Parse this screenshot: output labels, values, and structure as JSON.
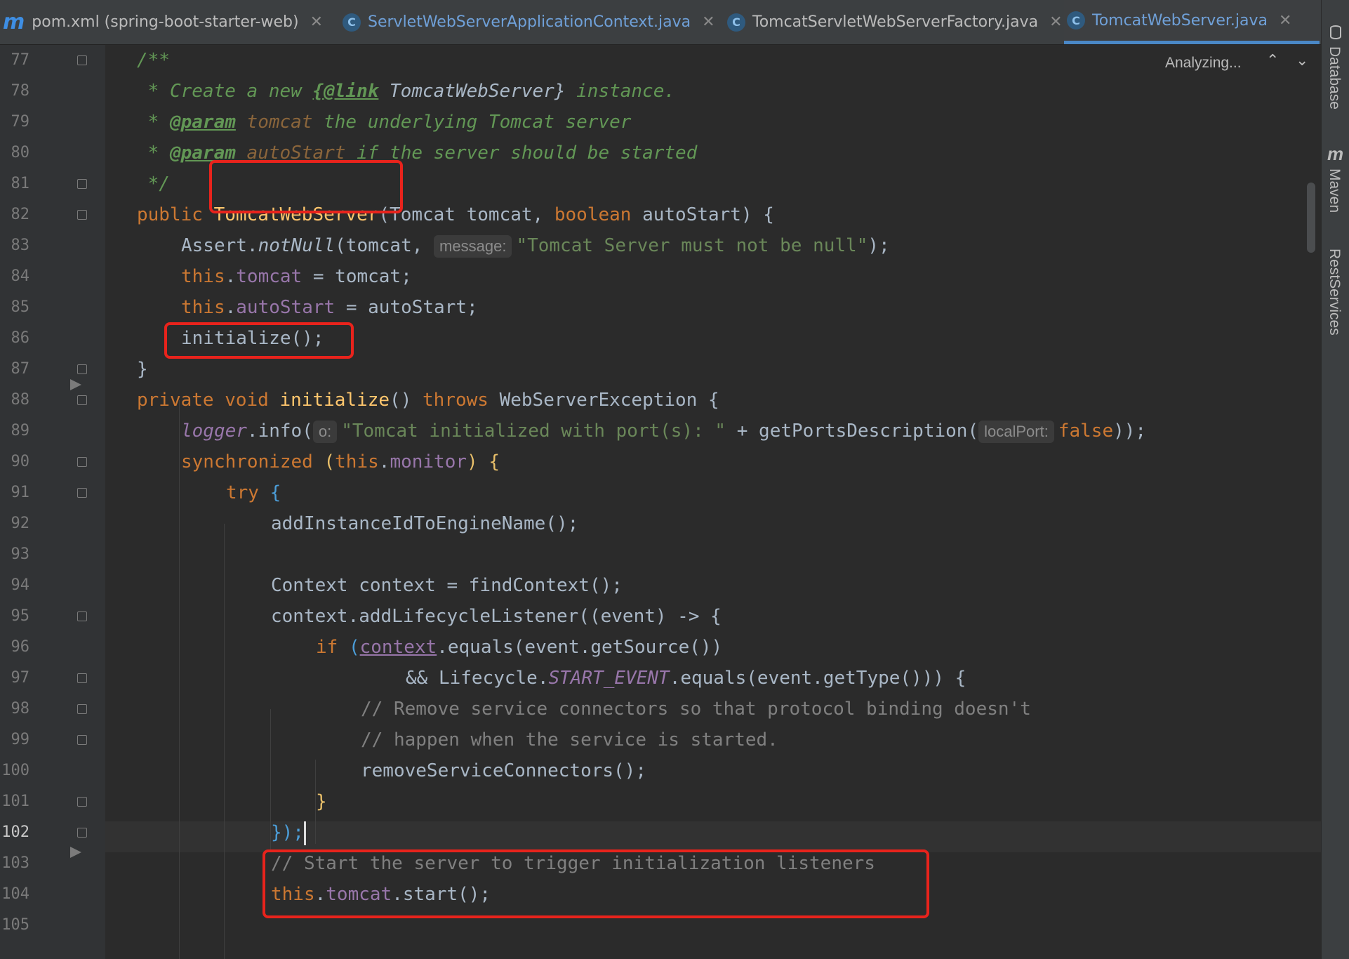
{
  "tabs": [
    {
      "label": "pom.xml (spring-boot-starter-web)",
      "icon": "maven-icon",
      "active": false
    },
    {
      "label": "ServletWebServerApplicationContext.java",
      "icon": "class-icon",
      "active": false
    },
    {
      "label": "TomcatServletWebServerFactory.java",
      "icon": "class-icon",
      "active": false
    },
    {
      "label": "TomcatWebServer.java",
      "icon": "class-icon",
      "active": true
    }
  ],
  "tab_close_glyph": "✕",
  "class_icon_glyph": "C",
  "maven_icon_glyph": "m",
  "status": {
    "analyzing": "Analyzing...",
    "up_glyph": "⌃",
    "down_glyph": "⌄"
  },
  "right_panels": [
    {
      "label": "Database"
    },
    {
      "label": "Maven"
    },
    {
      "label": "RestServices"
    }
  ],
  "line_numbers": [
    "77",
    "78",
    "79",
    "80",
    "81",
    "82",
    "83",
    "84",
    "85",
    "86",
    "87",
    "88",
    "89",
    "90",
    "91",
    "92",
    "93",
    "94",
    "95",
    "96",
    "97",
    "98",
    "99",
    "100",
    "101",
    "102",
    "103",
    "104",
    "105"
  ],
  "current_line": "102",
  "code": {
    "l77": "/**",
    "l78_a": " * Create a new ",
    "l78_b": "{@link",
    "l78_c": " TomcatWebServer}",
    "l78_d": " instance.",
    "l79_a": " * ",
    "l79_b": "@param",
    "l79_c": " tomcat",
    "l79_d": " the underlying Tomcat server",
    "l80_a": " * ",
    "l80_b": "@param",
    "l80_c": " autoStart",
    "l80_d": " if the server should be started",
    "l81": " */",
    "l82_a": "public ",
    "l82_b": "TomcatWebServer",
    "l82_c": "(Tomcat tomcat, ",
    "l82_d": "boolean",
    "l82_e": " autoStart) {",
    "l83_a": "Assert.",
    "l83_b": "notNull",
    "l83_c": "(tomcat,",
    "l83_hint": "message:",
    "l83_d": "\"Tomcat Server must not be null\"",
    "l83_e": ");",
    "l84_a": "this",
    "l84_b": ".",
    "l84_c": "tomcat",
    "l84_d": " = tomcat;",
    "l85_a": "this",
    "l85_b": ".",
    "l85_c": "autoStart",
    "l85_d": " = autoStart;",
    "l86": "initialize();",
    "l87": "}",
    "l88_a": "private void ",
    "l88_b": "initialize",
    "l88_c": "() ",
    "l88_d": "throws ",
    "l88_e": "WebServerException {",
    "l89_a": "logger",
    "l89_b": ".info(",
    "l89_hint": "o:",
    "l89_c": "\"Tomcat initialized with port(s): \"",
    "l89_d": " + getPortsDescription(",
    "l89_hint2": "localPort:",
    "l89_e": "false",
    "l89_f": "));",
    "l90_a": "synchronized ",
    "l90_b": "(",
    "l90_c": "this",
    "l90_d": ".",
    "l90_e": "monitor",
    "l90_f": ") {",
    "l91_a": "try ",
    "l91_b": "{",
    "l92": "addInstanceIdToEngineName();",
    "l94": "Context context = findContext();",
    "l95_a": "context.addLifecycleListener(",
    "l95_b": "(event) -> {",
    "l96_a": "if ",
    "l96_b": "(",
    "l96_c": "context",
    "l96_d": ".equals(event.getSource())",
    "l97_a": "&& Lifecycle.",
    "l97_b": "START_EVENT",
    "l97_c": ".equals(event.getType())) {",
    "l98": "// Remove service connectors so that protocol binding doesn't",
    "l99": "// happen when the service is started.",
    "l100": "removeServiceConnectors();",
    "l101": "}",
    "l102": "});",
    "l103": "// Start the server to trigger initialization listeners",
    "l104_a": "this",
    "l104_b": ".",
    "l104_c": "tomcat",
    "l104_d": ".start();"
  }
}
